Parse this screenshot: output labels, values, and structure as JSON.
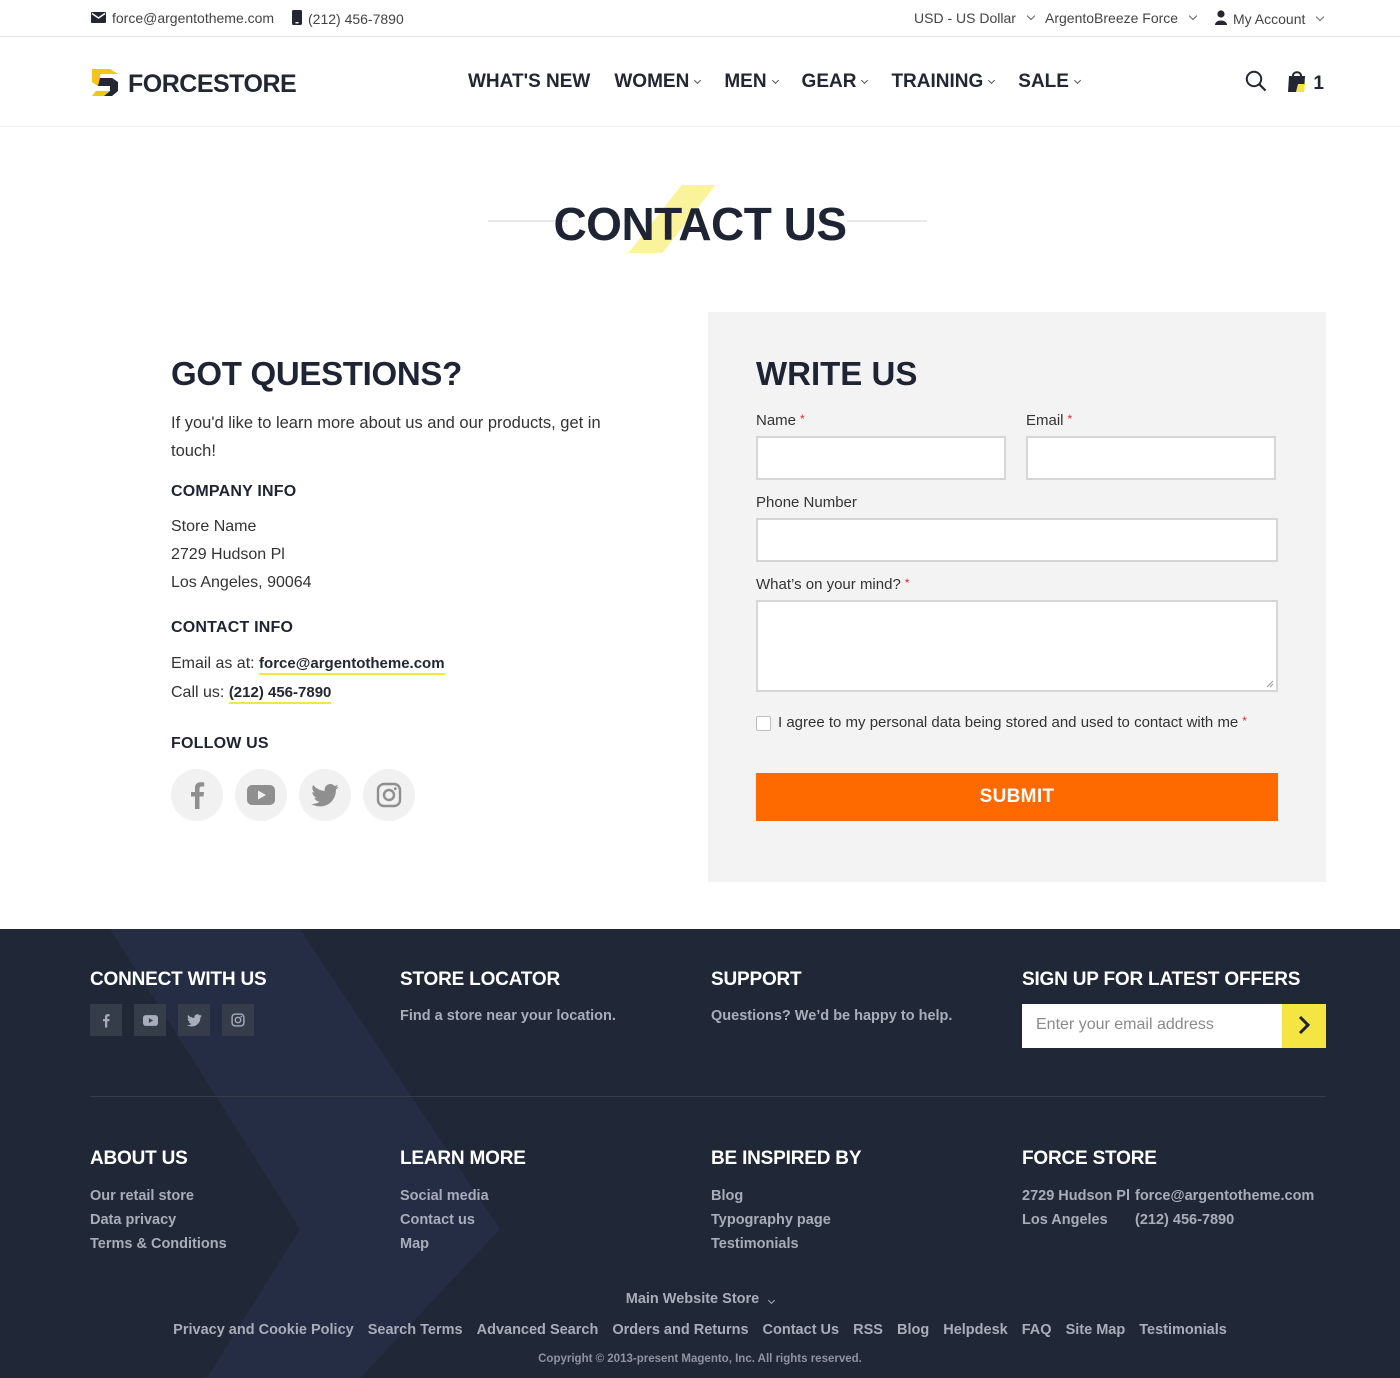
{
  "topbar": {
    "email": "force@argentotheme.com",
    "phone": "(212) 456-7890",
    "currency": "USD - US Dollar",
    "store_switch": "ArgentoBreeze Force",
    "account": "My Account"
  },
  "header": {
    "logo_text": "FORCESTORE",
    "nav": [
      "WHAT'S NEW",
      "WOMEN",
      "MEN",
      "GEAR",
      "TRAINING",
      "SALE"
    ],
    "cart_count": "1"
  },
  "page_title": "CONTACT US",
  "questions": {
    "heading": "GOT QUESTIONS?",
    "intro": "If you'd like to learn more about us and our products, get in touch!",
    "company_heading": "COMPANY INFO",
    "store_name": "Store Name",
    "street": "2729 Hudson Pl",
    "city": "Los Angeles, 90064",
    "contact_heading": "CONTACT INFO",
    "email_prefix": "Email as at:",
    "email": "force@argentotheme.com",
    "call_prefix": "Call us:",
    "phone": "(212) 456-7890",
    "follow_heading": "FOLLOW US"
  },
  "form": {
    "heading": "WRITE US",
    "name_label": "Name",
    "email_label": "Email",
    "phone_label": "Phone Number",
    "mind_label": "What’s on your mind?",
    "agree_label": "I agree to my personal data being stored and used to contact with me",
    "required_mark": "*",
    "submit_label": "SUBMIT"
  },
  "footer": {
    "connect_heading": "CONNECT WITH US",
    "locator_heading": "STORE LOCATOR",
    "locator_text": "Find a store near your location.",
    "support_heading": "SUPPORT",
    "support_text": "Questions? We’d be happy to help.",
    "signup_heading": "SIGN UP FOR LATEST OFFERS",
    "email_placeholder": "Enter your email address",
    "about_heading": "ABOUT US",
    "about_links": [
      "Our retail store",
      "Data privacy",
      "Terms & Conditions"
    ],
    "learn_heading": "LEARN MORE",
    "learn_links": [
      "Social media",
      "Contact us",
      "Map"
    ],
    "inspired_heading": "BE INSPIRED BY",
    "inspired_links": [
      "Blog",
      "Typography page",
      "Testimonials"
    ],
    "store_heading": "FORCE STORE",
    "store_street": "2729 Hudson Pl",
    "store_city": "Los Angeles",
    "store_email": "force@argentotheme.com",
    "store_phone": "(212) 456-7890",
    "store_selector": "Main Website Store",
    "bottom_links": [
      "Privacy and Cookie Policy",
      "Search Terms",
      "Advanced Search",
      "Orders and Returns",
      "Contact Us",
      "RSS",
      "Blog",
      "Helpdesk",
      "FAQ",
      "Site Map",
      "Testimonials"
    ],
    "copyright": "Copyright © 2013-present Magento, Inc. All rights reserved."
  },
  "colors": {
    "accent_yellow": "#f4e542",
    "submit_orange": "#ff6a00",
    "footer_bg": "#202736",
    "dark_text": "#1e2433"
  },
  "icons": [
    "envelope-icon",
    "phone-icon",
    "user-icon",
    "search-icon",
    "cart-icon",
    "facebook-icon",
    "youtube-icon",
    "twitter-icon",
    "instagram-icon",
    "arrow-right-icon"
  ]
}
